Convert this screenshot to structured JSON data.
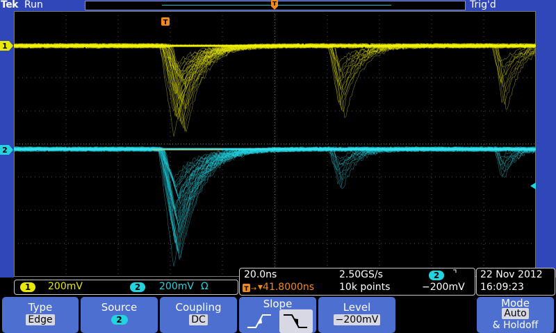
{
  "topbar": {
    "brand": "Tek",
    "run_state": "Run",
    "trigger_state": "Trig'd"
  },
  "trigger_marker": {
    "label": "T"
  },
  "channels": [
    {
      "id": "1",
      "scale": "200mV",
      "color": "#e8e800"
    },
    {
      "id": "2",
      "scale": "200mV",
      "impedance": "Ω",
      "color": "#22d4e0"
    }
  ],
  "timebase": {
    "horizontal_scale": "20.0ns",
    "sample_rate": "2.50GS/s",
    "position": "41.8000ns",
    "record_length": "10k points",
    "trigger_source": "2",
    "trigger_slope_symbol": "⌝",
    "trigger_level": "−200mV"
  },
  "datetime": {
    "date": "22 Nov 2012",
    "time": "16:09:23"
  },
  "menu": {
    "type": {
      "label": "Type",
      "value": "Edge"
    },
    "source": {
      "label": "Source",
      "value": "2"
    },
    "coupling": {
      "label": "Coupling",
      "value": "DC"
    },
    "slope": {
      "label": "Slope"
    },
    "level": {
      "label": "Level",
      "value": "−200mV"
    },
    "mode": {
      "label": "Mode",
      "value": "Auto",
      "value2": "& Holdoff"
    }
  }
}
